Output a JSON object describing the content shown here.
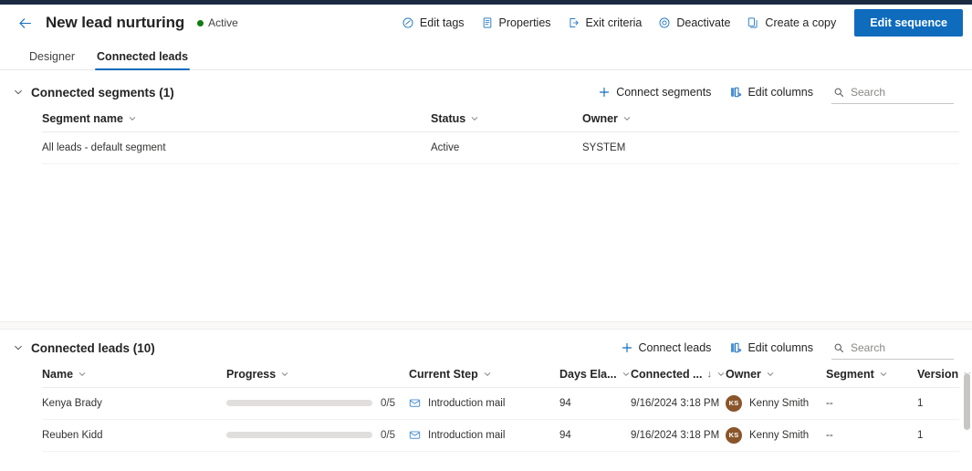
{
  "window": {
    "title": "New lead nurturing",
    "status_label": "Active",
    "status_color": "#107c10",
    "accent_color": "#0f6cbd",
    "back_icon": "arrow-left-icon"
  },
  "commandbar": {
    "items": [
      {
        "label": "Edit tags",
        "icon": "tag-icon"
      },
      {
        "label": "Properties",
        "icon": "properties-icon"
      },
      {
        "label": "Exit criteria",
        "icon": "exit-icon"
      },
      {
        "label": "Deactivate",
        "icon": "deactivate-icon"
      },
      {
        "label": "Create a copy",
        "icon": "copy-icon"
      }
    ],
    "primary_button": "Edit sequence"
  },
  "tabs": [
    {
      "label": "Designer",
      "active": false
    },
    {
      "label": "Connected leads",
      "active": true
    }
  ],
  "segments_section": {
    "title": "Connected segments (1)",
    "collapse_icon": "chevron-down-icon",
    "tools": [
      {
        "label": "Connect segments",
        "icon": "plus-icon"
      },
      {
        "label": "Edit columns",
        "icon": "columns-icon"
      }
    ],
    "search": {
      "placeholder": "Search",
      "value": "",
      "icon": "search-icon"
    },
    "columns": [
      {
        "label": "Segment name",
        "sort": ""
      },
      {
        "label": "Status",
        "sort": ""
      },
      {
        "label": "Owner",
        "sort": ""
      }
    ],
    "rows": [
      {
        "name": "All leads - default segment",
        "status": "Active",
        "owner": "SYSTEM"
      }
    ]
  },
  "leads_section": {
    "title": "Connected leads (10)",
    "collapse_icon": "chevron-down-icon",
    "tools": [
      {
        "label": "Connect leads",
        "icon": "plus-icon"
      },
      {
        "label": "Edit columns",
        "icon": "columns-icon"
      }
    ],
    "search": {
      "placeholder": "Search",
      "value": "",
      "icon": "search-icon"
    },
    "columns": [
      {
        "label": "Name",
        "sort": ""
      },
      {
        "label": "Progress",
        "sort": ""
      },
      {
        "label": "Current Step",
        "sort": ""
      },
      {
        "label": "Days Ela...",
        "sort": ""
      },
      {
        "label": "Connected ...",
        "sort": "↓"
      },
      {
        "label": "Owner",
        "sort": ""
      },
      {
        "label": "Segment",
        "sort": ""
      },
      {
        "label": "Version",
        "sort": ""
      }
    ],
    "rows": [
      {
        "name": "Kenya Brady",
        "progress_label": "0/5",
        "progress_pct": 0,
        "current_step": "Introduction mail",
        "step_icon": "mail-icon",
        "days_elapsed": "94",
        "connected_on": "9/16/2024 3:18 PM",
        "owner": "Kenny Smith",
        "owner_initials": "KS",
        "owner_avatar_color": "#8a552a",
        "segment": "--",
        "version": "1"
      },
      {
        "name": "Reuben Kidd",
        "progress_label": "0/5",
        "progress_pct": 0,
        "current_step": "Introduction mail",
        "step_icon": "mail-icon",
        "days_elapsed": "94",
        "connected_on": "9/16/2024 3:18 PM",
        "owner": "Kenny Smith",
        "owner_initials": "KS",
        "owner_avatar_color": "#8a552a",
        "segment": "--",
        "version": "1"
      }
    ]
  }
}
